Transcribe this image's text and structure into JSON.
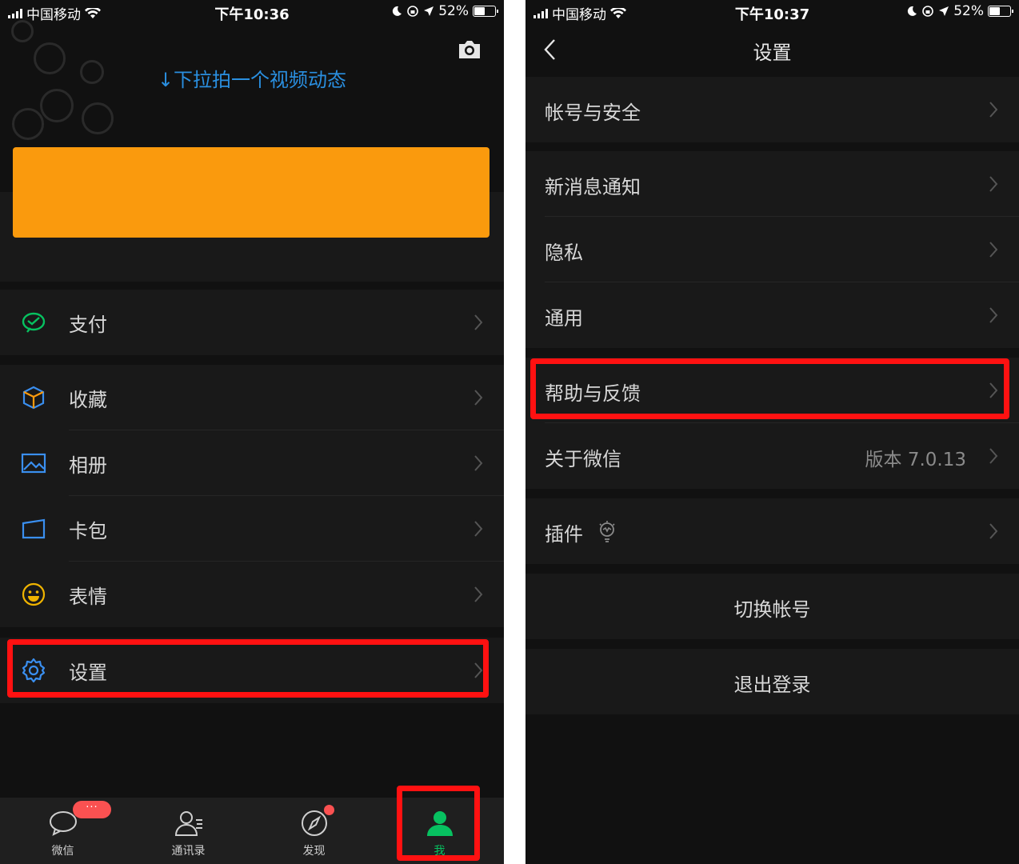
{
  "left": {
    "status": {
      "carrier": "中国移动",
      "time": "下午10:36",
      "battery": "52%"
    },
    "pull_hint": "↓下拉拍一个视频动态",
    "menu": [
      {
        "label": "支付",
        "icon": "pay-icon"
      },
      {
        "label": "收藏",
        "icon": "favorites-icon"
      },
      {
        "label": "相册",
        "icon": "album-icon"
      },
      {
        "label": "卡包",
        "icon": "card-wallet-icon"
      },
      {
        "label": "表情",
        "icon": "sticker-smile-icon"
      },
      {
        "label": "设置",
        "icon": "gear-icon"
      }
    ],
    "tabs": [
      {
        "label": "微信",
        "icon": "chat-bubble-icon",
        "badge": "···"
      },
      {
        "label": "通讯录",
        "icon": "contacts-icon"
      },
      {
        "label": "发现",
        "icon": "compass-icon"
      },
      {
        "label": "我",
        "icon": "person-icon",
        "active": true
      }
    ]
  },
  "right": {
    "status": {
      "carrier": "中国移动",
      "time": "下午10:37",
      "battery": "52%"
    },
    "nav": {
      "title": "设置"
    },
    "items": [
      {
        "label": "帐号与安全"
      },
      {
        "label": "新消息通知"
      },
      {
        "label": "隐私"
      },
      {
        "label": "通用"
      },
      {
        "label": "帮助与反馈"
      },
      {
        "label": "关于微信",
        "value": "版本 7.0.13"
      },
      {
        "label": "插件"
      }
    ],
    "switch_account": "切换帐号",
    "logout": "退出登录"
  },
  "colors": {
    "accent_green": "#07c160",
    "highlight_red": "#ff1111",
    "orange": "#fa9a0d",
    "link_blue": "#2a8fe0"
  }
}
